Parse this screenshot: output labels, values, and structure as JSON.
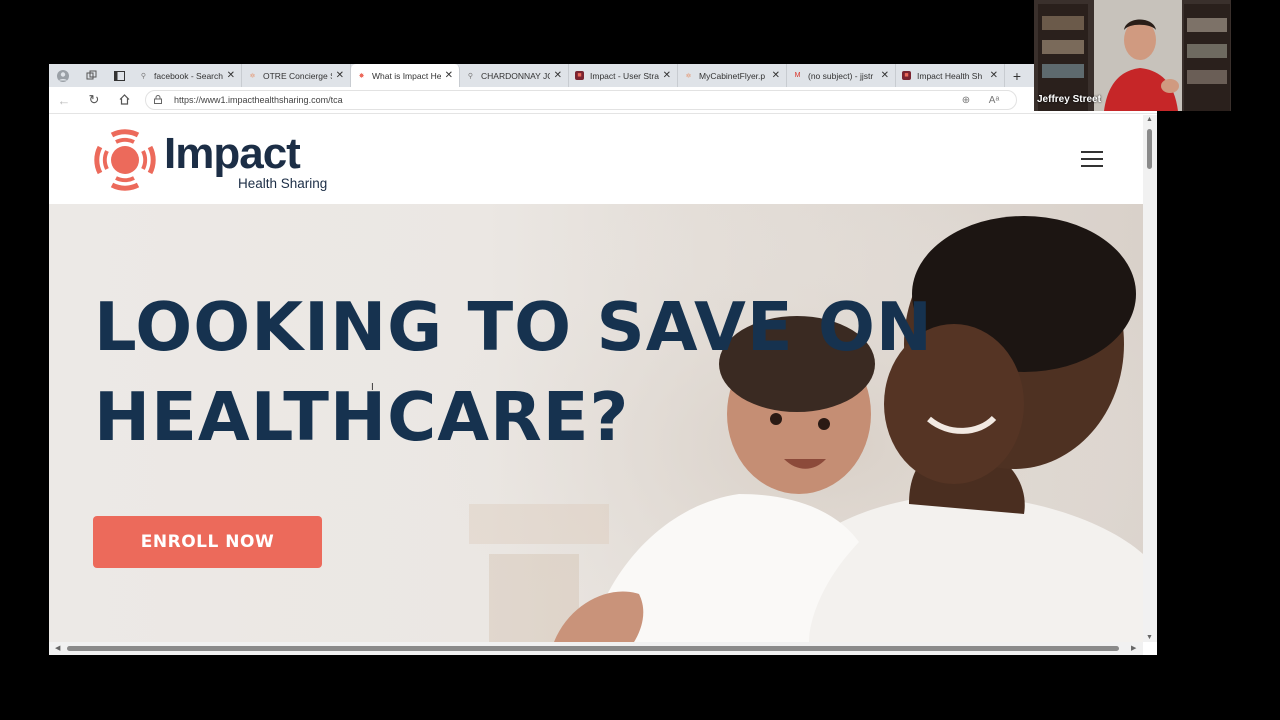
{
  "browser": {
    "tabs": [
      {
        "title": "facebook - Search",
        "active": false,
        "favicon": "search-icon"
      },
      {
        "title": "OTRE Concierge S",
        "active": false,
        "favicon": "hubspot-icon"
      },
      {
        "title": "What is Impact He",
        "active": true,
        "favicon": "impact-icon"
      },
      {
        "title": "CHARDONNAY JC",
        "active": false,
        "favicon": "search-icon"
      },
      {
        "title": "Impact - User Stra",
        "active": false,
        "favicon": "app-icon"
      },
      {
        "title": "MyCabinetFlyer.p",
        "active": false,
        "favicon": "hubspot-icon"
      },
      {
        "title": "(no subject) - jjstr",
        "active": false,
        "favicon": "gmail-icon"
      },
      {
        "title": "Impact Health Sh",
        "active": false,
        "favicon": "app-icon"
      }
    ],
    "url": "https://www1.impacthealthsharing.com/tca"
  },
  "site": {
    "logo": {
      "word": "Impact",
      "sub": "Health Sharing"
    },
    "hero": {
      "title": "LOOKING TO SAVE ON\nHEALTHCARE?",
      "cta": "ENROLL NOW"
    }
  },
  "webcam": {
    "name": "Jeffrey Street"
  },
  "colors": {
    "brand_navy": "#16324f",
    "brand_coral": "#ec6a5b"
  }
}
